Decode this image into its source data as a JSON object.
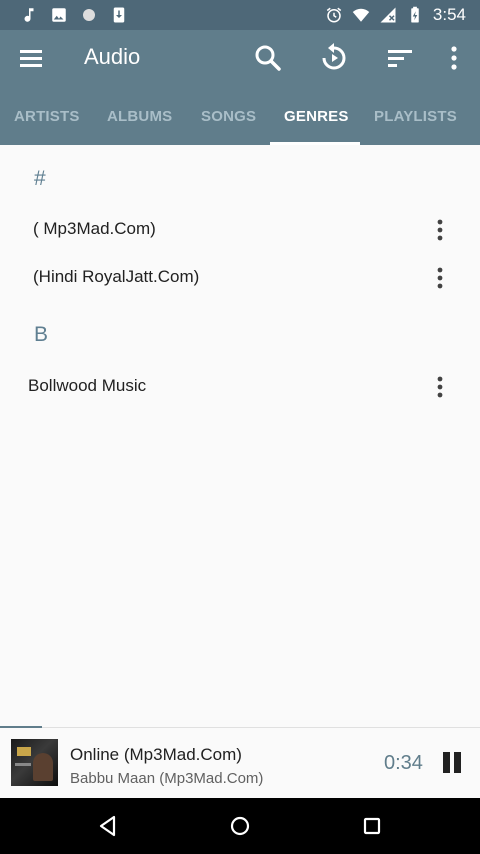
{
  "status_bar": {
    "time": "3:54",
    "left_icons": [
      "music-note-icon",
      "image-icon",
      "circle-icon",
      "download-icon"
    ],
    "right_icons": [
      "alarm-icon",
      "wifi-icon",
      "no-signal-icon",
      "battery-charging-icon"
    ]
  },
  "app_bar": {
    "title": "Audio",
    "actions": [
      "search-icon",
      "refresh-icon",
      "sort-icon",
      "more-vert-icon"
    ]
  },
  "tabs": [
    {
      "label": "ARTISTS",
      "active": false
    },
    {
      "label": "ALBUMS",
      "active": false
    },
    {
      "label": "SONGS",
      "active": false
    },
    {
      "label": "GENRES",
      "active": true
    },
    {
      "label": "PLAYLISTS",
      "active": false
    }
  ],
  "sections": [
    {
      "header": "#",
      "items": [
        "( Mp3Mad.Com)",
        "(Hindi RoyalJatt.Com)"
      ]
    },
    {
      "header": "B",
      "items": [
        "Bollwood Music"
      ]
    }
  ],
  "player": {
    "title": "Online (Mp3Mad.Com)",
    "artist": "Babbu Maan (Mp3Mad.Com)",
    "elapsed": "0:34",
    "playing": true
  },
  "colors": {
    "primary": "#607d8b",
    "status_bar": "#4e6878",
    "inactive_tab": "#a9bec8",
    "section_header": "#5f7f91"
  }
}
